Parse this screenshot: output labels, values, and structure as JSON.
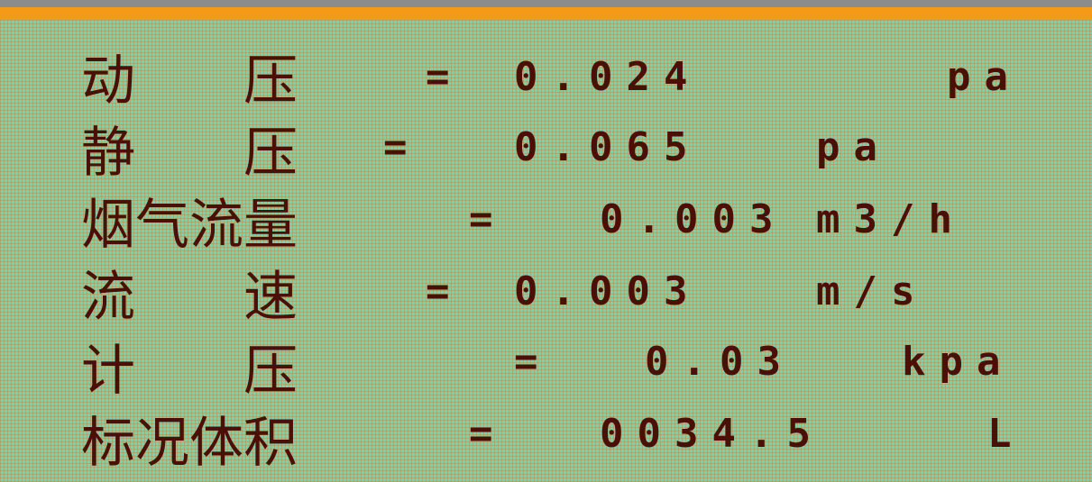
{
  "rows": [
    {
      "label": "动　　压",
      "eq": "=",
      "value": "0.024",
      "unit": "pa"
    },
    {
      "label": "静　　压",
      "eq": "=",
      "value": "0.065",
      "unit": "pa"
    },
    {
      "label": "烟气流量",
      "eq": "=",
      "value": "0.003",
      "unit": "m3/h"
    },
    {
      "label": "流　　速",
      "eq": "=",
      "value": "0.003",
      "unit": "m/s"
    },
    {
      "label": "计　　压",
      "eq": "=",
      "value": "0.03",
      "unit": "kpa"
    },
    {
      "label": "标况体积",
      "eq": "=",
      "value": "0034.5",
      "unit": "L"
    }
  ],
  "colors": {
    "lcd_background": "#6fd6b2",
    "lcd_text": "#4a1008",
    "accent_bar": "#f59a16",
    "top_bar": "#8c8c8c"
  }
}
